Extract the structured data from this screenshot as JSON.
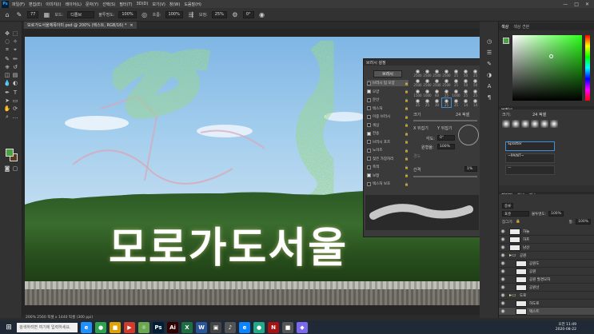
{
  "app": {
    "logo": "Ps"
  },
  "menu": [
    "파일(F)",
    "편집(E)",
    "이미지(I)",
    "레이어(L)",
    "문자(Y)",
    "선택(S)",
    "필터(T)",
    "3D(D)",
    "보기(V)",
    "창(W)",
    "도움말(H)"
  ],
  "window_controls": [
    "—",
    "□",
    "✕"
  ],
  "options": {
    "brush_size": "77",
    "mode_label": "모드:",
    "mode_value": "디졸브",
    "opacity_label": "불투명도:",
    "opacity_value": "100%",
    "flow_label": "흐름:",
    "flow_value": "100%",
    "smoothing_label": "보정:",
    "smoothing_value": "25%",
    "angle_value": "0°"
  },
  "document": {
    "tab_title": "모로가도서울제목이미.psd @ 200% (텍스트, RGB/16) *",
    "close": "✕"
  },
  "canvas": {
    "title_text": "모로가도서울"
  },
  "brush_panel": {
    "header": "브러시 설정",
    "preset_button": "브러시",
    "options": [
      {
        "label": "브러시 팁 모양",
        "checked": false,
        "selected": true
      },
      {
        "label": "모양",
        "checked": true,
        "selected": false
      },
      {
        "label": "분산",
        "checked": false,
        "selected": false
      },
      {
        "label": "텍스처",
        "checked": false,
        "selected": false
      },
      {
        "label": "이중 브러시",
        "checked": false,
        "selected": false
      },
      {
        "label": "색상",
        "checked": false,
        "selected": false
      },
      {
        "label": "전송",
        "checked": true,
        "selected": false
      },
      {
        "label": "브러시 포즈",
        "checked": false,
        "selected": false
      },
      {
        "label": "노이즈",
        "checked": false,
        "selected": false
      },
      {
        "label": "젖은 가장자리",
        "checked": false,
        "selected": false
      },
      {
        "label": "축적",
        "checked": false,
        "selected": false
      },
      {
        "label": "보정",
        "checked": true,
        "selected": false
      },
      {
        "label": "텍스처 보호",
        "checked": false,
        "selected": false
      }
    ],
    "tip_sizes": [
      "2500",
      "2500",
      "2500",
      "2500",
      "25",
      "50",
      "25",
      "2500",
      "2500",
      "2500",
      "2500",
      "25",
      "50",
      "50",
      "1500",
      "1000",
      "60",
      "25",
      "1000",
      "25",
      "25",
      "25",
      "25",
      "30",
      "25",
      "25",
      "14",
      "14"
    ],
    "size_label": "크기",
    "size_value": "24 픽셀",
    "flip_x": "X 뒤집기",
    "flip_y": "Y 뒤집기",
    "angle_label": "각도:",
    "angle_value": "0°",
    "roundness_label": "원형율:",
    "roundness_value": "100%",
    "hardness_label": "경도",
    "spacing_label": "간격",
    "spacing_value": "1%"
  },
  "right": {
    "color_tabs": [
      "색상",
      "색상 견본"
    ],
    "brushes_tabs": [
      "브러시"
    ],
    "brushes_size_label": "크기:",
    "brushes_size_value": "24 픽셀",
    "brush_items": [
      "Splatter",
      "~PAINT~",
      "—"
    ],
    "layers_tabs": [
      "레이어",
      "채널",
      "패스"
    ],
    "kind_label": "종류",
    "blend_value": "표준",
    "opacity_label": "불투명도:",
    "opacity_value": "100%",
    "lock_label": "잠그기:",
    "fill_label": "칠:",
    "fill_value": "100%",
    "layers": [
      {
        "name": "하늘",
        "folder": false,
        "indent": 0,
        "selected": false
      },
      {
        "name": "하프",
        "folder": false,
        "indent": 0,
        "selected": false
      },
      {
        "name": "남산",
        "folder": false,
        "indent": 0,
        "selected": false
      },
      {
        "name": "공원",
        "folder": true,
        "indent": 0,
        "selected": false
      },
      {
        "name": "공원도",
        "folder": false,
        "indent": 1,
        "selected": false
      },
      {
        "name": "공원",
        "folder": false,
        "indent": 1,
        "selected": false
      },
      {
        "name": "공원 발경모자",
        "folder": false,
        "indent": 1,
        "selected": false
      },
      {
        "name": "공원선",
        "folder": false,
        "indent": 1,
        "selected": false
      },
      {
        "name": "도로",
        "folder": true,
        "indent": 0,
        "selected": false
      },
      {
        "name": "하도로",
        "folder": false,
        "indent": 1,
        "selected": false
      },
      {
        "name": "텍스트",
        "folder": false,
        "indent": 1,
        "selected": true
      }
    ]
  },
  "status": {
    "text": "200%    2560 픽셀 x 1440 픽셀 (300 ppi)"
  },
  "taskbar": {
    "search_placeholder": "검색하려면 여기에 입력하세요.",
    "apps": [
      {
        "label": "e",
        "color": "#1e90ff"
      },
      {
        "label": "●",
        "color": "#2ea44f"
      },
      {
        "label": "■",
        "color": "#e1a100"
      },
      {
        "label": "▶",
        "color": "#d23b2a"
      },
      {
        "label": "☼",
        "color": "#6aa84f"
      },
      {
        "label": "Ps",
        "color": "#001e36"
      },
      {
        "label": "Ai",
        "color": "#330000"
      },
      {
        "label": "X",
        "color": "#1d6f42"
      },
      {
        "label": "W",
        "color": "#2b579a"
      },
      {
        "label": "▣",
        "color": "#444"
      },
      {
        "label": "♪",
        "color": "#555"
      },
      {
        "label": "e",
        "color": "#0a84ff"
      },
      {
        "label": "●",
        "color": "#22aa88"
      },
      {
        "label": "N",
        "color": "#aa1111"
      },
      {
        "label": "■",
        "color": "#555"
      },
      {
        "label": "◆",
        "color": "#7b68ee"
      }
    ],
    "time": "오전 11:49",
    "date": "2020-08-22"
  },
  "colors": {
    "foreground": "#4aa043",
    "background": "#5a3a1c",
    "accent": "#3d8fd9"
  }
}
